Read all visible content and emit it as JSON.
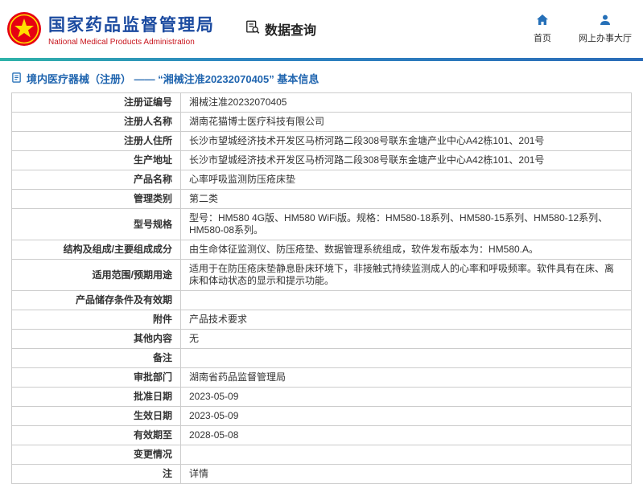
{
  "colors": {
    "title_blue": "#1c4ba0",
    "subtitle_red": "#c8161e",
    "nav_blue": "#2670b8",
    "breadcrumb_blue": "#2065af",
    "link_blue": "#3a7bd5",
    "divider_teal": "#2fb3a9",
    "divider_blue": "#2b6cb8"
  },
  "header": {
    "agency_cn": "国家药品监督管理局",
    "agency_en": "National Medical Products Administration",
    "section_title": "数据查询",
    "nav": [
      {
        "label": "首页",
        "icon": "home-icon"
      },
      {
        "label": "网上办事大厅",
        "icon": "user-icon"
      }
    ]
  },
  "breadcrumb": "境内医疗器械（注册） —— “湘械注准20232070405” 基本信息",
  "table": {
    "rows": [
      {
        "label": "注册证编号",
        "value": "湘械注准20232070405",
        "is_link": false
      },
      {
        "label": "注册人名称",
        "value": "湖南花猫博士医疗科技有限公司",
        "is_link": false
      },
      {
        "label": "注册人住所",
        "value": "长沙市望城经济技术开发区马桥河路二段308号联东金塘产业中心A42栋101、201号",
        "is_link": false
      },
      {
        "label": "生产地址",
        "value": "长沙市望城经济技术开发区马桥河路二段308号联东金塘产业中心A42栋101、201号",
        "is_link": false
      },
      {
        "label": "产品名称",
        "value": "心率呼吸监测防压疮床垫",
        "is_link": false
      },
      {
        "label": "管理类别",
        "value": "第二类",
        "is_link": false
      },
      {
        "label": "型号规格",
        "value": "型号：HM580 4G版、HM580 WiFi版。规格：HM580-18系列、HM580-15系列、HM580-12系列、HM580-08系列。",
        "is_link": false
      },
      {
        "label": "结构及组成/主要组成成分",
        "value": "由生命体征监测仪、防压疮垫、数据管理系统组成，软件发布版本为：HM580.A。",
        "is_link": false
      },
      {
        "label": "适用范围/预期用途",
        "value": "适用于在防压疮床垫静息卧床环境下，非接触式持续监测成人的心率和呼吸频率。软件具有在床、离床和体动状态的显示和提示功能。",
        "is_link": false
      },
      {
        "label": "产品储存条件及有效期",
        "value": "",
        "is_link": false
      },
      {
        "label": "附件",
        "value": "产品技术要求",
        "is_link": false
      },
      {
        "label": "其他内容",
        "value": "无",
        "is_link": false
      },
      {
        "label": "备注",
        "value": "",
        "is_link": false
      },
      {
        "label": "审批部门",
        "value": "湖南省药品监督管理局",
        "is_link": false
      },
      {
        "label": "批准日期",
        "value": "2023-05-09",
        "is_link": false
      },
      {
        "label": "生效日期",
        "value": "2023-05-09",
        "is_link": false
      },
      {
        "label": "有效期至",
        "value": "2028-05-08",
        "is_link": false
      },
      {
        "label": "变更情况",
        "value": "",
        "is_link": false
      },
      {
        "label": "注",
        "value": "详情",
        "is_link": true
      }
    ]
  }
}
